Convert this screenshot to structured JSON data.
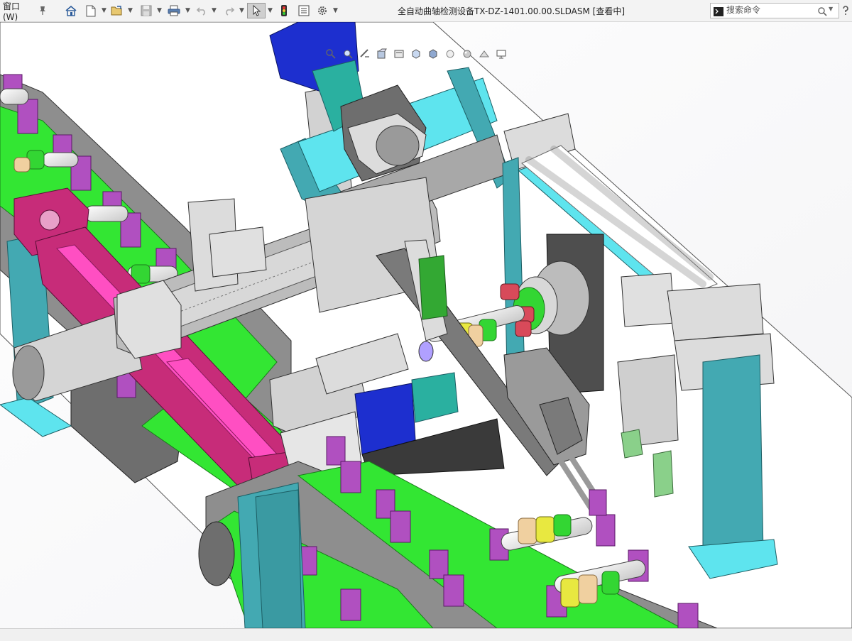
{
  "titlebar": {
    "menu_label": "窗口(W)",
    "document_title": "全自动曲轴检测设备TX-DZ-1401.00.00.SLDASM [查看中]",
    "toolbar_icons": [
      "pin-icon",
      "home-icon",
      "new-document-icon",
      "open-icon",
      "save-icon",
      "print-icon",
      "undo-icon",
      "redo-icon",
      "select-arrow-icon",
      "traffic-light-icon",
      "file-properties-icon",
      "options-gear-icon"
    ]
  },
  "search": {
    "placeholder": "搜索命令",
    "icons": [
      "command-prompt-icon",
      "search-icon",
      "help-icon"
    ]
  },
  "heads_up_toolbar": [
    "zoom-to-fit-icon",
    "zoom-to-area-icon",
    "previous-view-icon",
    "section-view-icon",
    "dynamic-annotation-icon",
    "view-orientation-icon",
    "display-style-icon",
    "hide-show-icon",
    "edit-appearance-icon",
    "apply-scene-icon",
    "view-settings-icon"
  ],
  "viewport": {
    "content": "SolidWorks assembly 3D model view",
    "colors": {
      "frame_teal": "#43a9b2",
      "frame_cyan": "#5ee4ee",
      "conveyor_green": "#33e633",
      "magenta": "#c72c79",
      "pink_rod": "#ff4fc2",
      "blue_motor": "#1d2fcf",
      "gray_part": "#a8a8a8",
      "dark_gray": "#6e6e6e",
      "purple_stop": "#b050c0"
    }
  }
}
